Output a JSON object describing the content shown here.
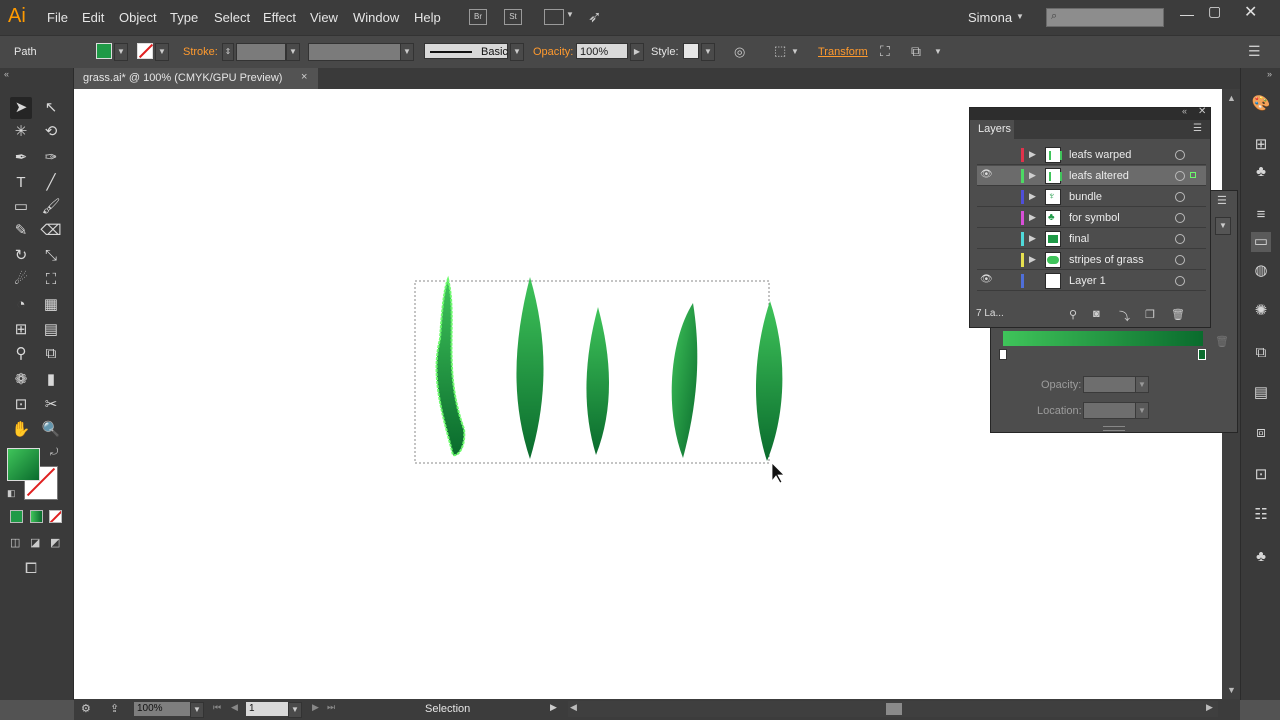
{
  "app": {
    "logo": "Ai",
    "user": "Simona",
    "bridge": "Br",
    "stock": "St"
  },
  "menu": [
    "File",
    "Edit",
    "Object",
    "Type",
    "Select",
    "Effect",
    "View",
    "Window",
    "Help"
  ],
  "control_bar": {
    "selection_type": "Path",
    "stroke_label": "Stroke:",
    "brush_label": "Basic",
    "opacity_label": "Opacity:",
    "opacity_value": "100%",
    "style_label": "Style:",
    "transform_label": "Transform"
  },
  "document_tab": {
    "title": "grass.ai* @ 100% (CMYK/GPU Preview)",
    "close": "×"
  },
  "layers_panel": {
    "tab": "Layers",
    "layers": [
      {
        "name": "leafs warped",
        "visible": false,
        "selected": false,
        "color": "#e0324b"
      },
      {
        "name": "leafs altered",
        "visible": true,
        "selected": true,
        "color": "#4cd964"
      },
      {
        "name": "bundle",
        "visible": false,
        "selected": false,
        "color": "#4f4fd9"
      },
      {
        "name": "for symbol",
        "visible": false,
        "selected": false,
        "color": "#d94fd9"
      },
      {
        "name": "final",
        "visible": false,
        "selected": false,
        "color": "#4fd9d9"
      },
      {
        "name": "stripes of grass",
        "visible": false,
        "selected": false,
        "color": "#e6e04f"
      },
      {
        "name": "Layer 1",
        "visible": true,
        "selected": false,
        "color": "#4f6fd9"
      }
    ],
    "count_text": "7 La..."
  },
  "gradient_panel": {
    "opacity_label": "Opacity:",
    "location_label": "Location:"
  },
  "status_bar": {
    "zoom": "100%",
    "artboard": "1",
    "tool": "Selection"
  },
  "colors": {
    "leaf_light": "#3fc45a",
    "leaf_dark": "#0a6b2d",
    "accent_orange": "#ff9a2e"
  }
}
